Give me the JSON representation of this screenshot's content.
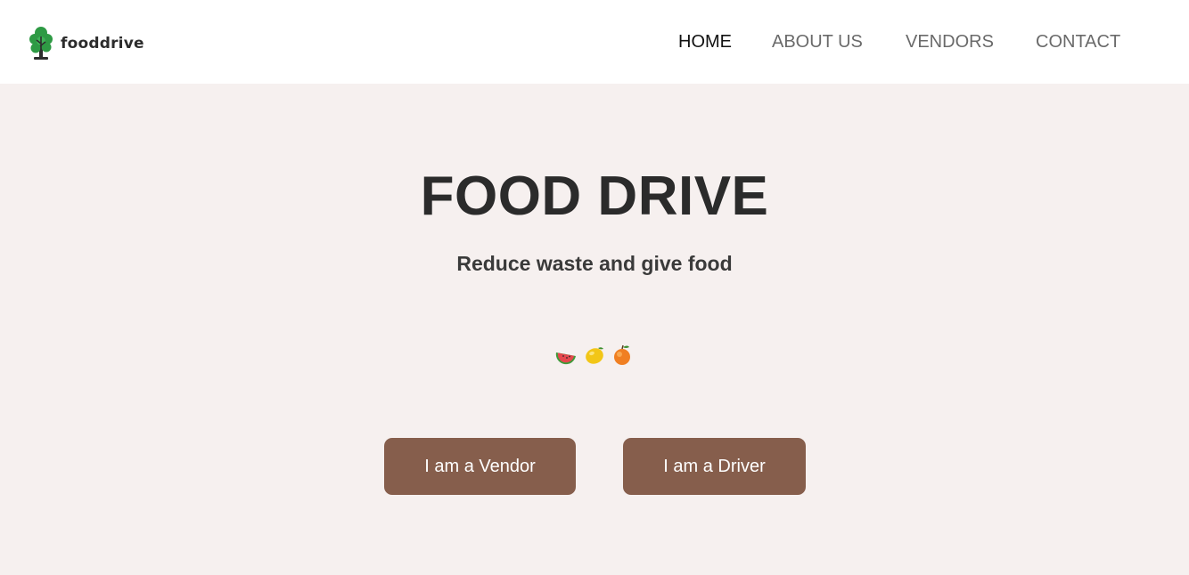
{
  "brand": {
    "name": "fooddrive",
    "logo_icon": "tree-icon",
    "logo_color": "#2e9a44"
  },
  "nav": {
    "items": [
      {
        "label": "HOME",
        "active": true
      },
      {
        "label": "ABOUT US",
        "active": false
      },
      {
        "label": "VENDORS",
        "active": false
      },
      {
        "label": "CONTACT",
        "active": false
      }
    ]
  },
  "hero": {
    "title": "FOOD DRIVE",
    "subtitle": "Reduce waste and give food",
    "fruit_icons": [
      "watermelon-icon",
      "lemon-icon",
      "peach-icon"
    ]
  },
  "actions": {
    "vendor_label": "I am a Vendor",
    "driver_label": "I am a Driver"
  },
  "colors": {
    "background": "#f6f0ef",
    "header": "#ffffff",
    "button": "#865e4c",
    "title": "#2b2b2b"
  }
}
